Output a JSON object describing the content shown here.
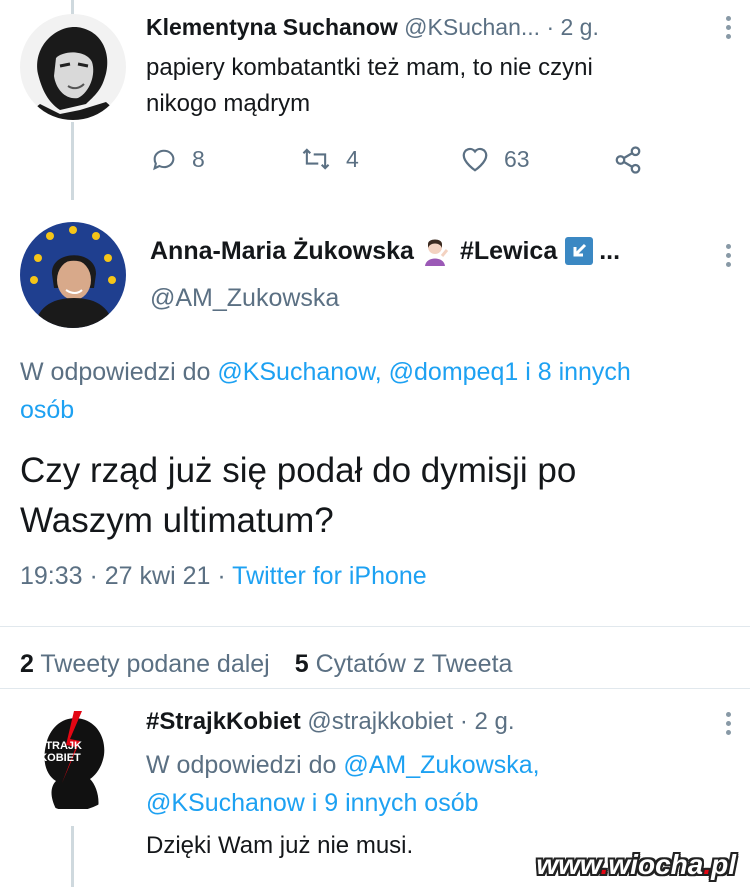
{
  "tweet1": {
    "name": "Klementyna Suchanow",
    "handle": "@KSuchan...",
    "time": "· 2 g.",
    "text_line1": "papiery kombatantki też mam, to nie czyni",
    "text_line2": "nikogo mądrym",
    "replies": "8",
    "retweets": "4",
    "likes": "63"
  },
  "tweet2": {
    "name": "Anna-Maria Żukowska",
    "name_suffix": "#Lewica",
    "ellipsis": "...",
    "handle": "@AM_Zukowska",
    "reply_prefix": "W odpowiedzi do ",
    "reply_mentions": "@KSuchanow, @dompeq1 i 8 innych",
    "reply_line2": "osób",
    "text_line1": "Czy rząd już się podał do dymisji po",
    "text_line2": "Waszym ultimatum?",
    "timestamp": "19:33 · 27 kwi 21 · ",
    "source": "Twitter for iPhone",
    "retweets_count": "2",
    "retweets_label": "Tweety podane dalej",
    "quotes_count": "5",
    "quotes_label": "Cytatów z Tweeta"
  },
  "tweet3": {
    "name": "#StrajkKobiet",
    "handle": "@strajkkobiet",
    "time": "· 2 g.",
    "reply_prefix": "W odpowiedzi do ",
    "reply_mention1": "@AM_Zukowska,",
    "reply_mention2": "@KSuchanow i 9 innych osób",
    "text": "Dzięki Wam już nie musi.",
    "avatar_text1": "STRAJK",
    "avatar_text2": "KOBIET"
  },
  "watermark": {
    "pre": "www",
    "dot1": ".",
    "mid": "wiocha",
    "dot2": ".",
    "post": "pl"
  },
  "colors": {
    "accent": "#1da1f2",
    "secondary_text": "#5b7083",
    "strajk_red": "#e30613"
  }
}
